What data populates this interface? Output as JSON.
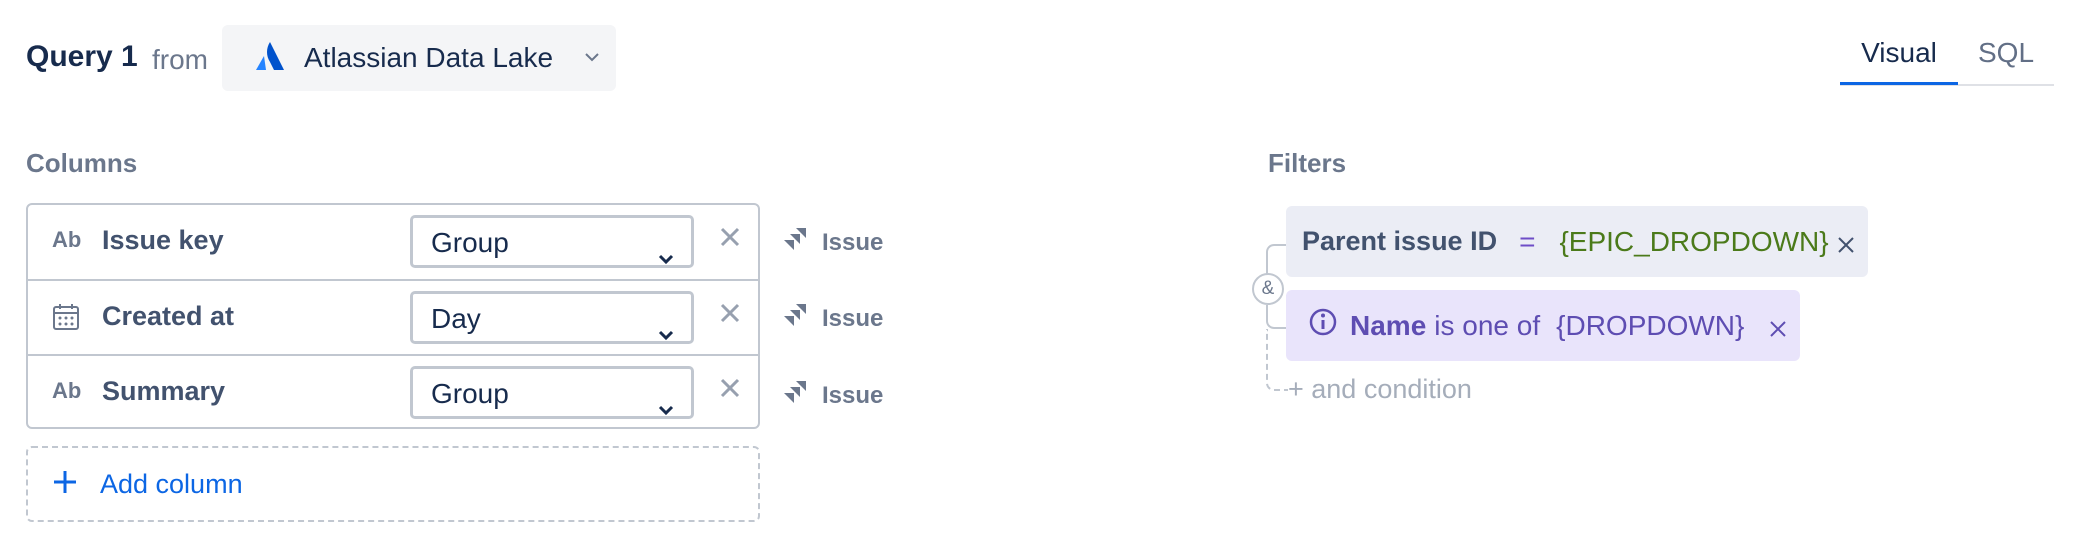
{
  "header": {
    "query_title": "Query 1",
    "from_label": "from",
    "source_name": "Atlassian Data Lake",
    "source_icon": "atlassian-logo-icon",
    "tabs": [
      {
        "label": "Visual",
        "active": true
      },
      {
        "label": "SQL",
        "active": false
      }
    ]
  },
  "columns": {
    "heading": "Columns",
    "rows": [
      {
        "type_icon": "Ab",
        "name": "Issue key",
        "aggregation": "Group",
        "source_label": "Issue"
      },
      {
        "type_icon": "calendar-icon",
        "name": "Created at",
        "aggregation": "Day",
        "source_label": "Issue"
      },
      {
        "type_icon": "Ab",
        "name": "Summary",
        "aggregation": "Group",
        "source_label": "Issue"
      }
    ],
    "add_label": "Add column"
  },
  "filters": {
    "heading": "Filters",
    "connector": "&",
    "items": [
      {
        "field": "Parent issue ID",
        "operator": "=",
        "value": "{EPIC_DROPDOWN}"
      },
      {
        "field": "Name",
        "operator": "is one of",
        "value": "{DROPDOWN}",
        "icon": "info-icon"
      }
    ],
    "add_condition_label": "+ and condition"
  },
  "colors": {
    "accent": "#0c66e4",
    "filter_chip_bg": "#ebedf5",
    "filter_chip_purple_bg": "#e9e4fb",
    "value_green": "#4b7a1a",
    "value_purple": "#5e4db2"
  }
}
